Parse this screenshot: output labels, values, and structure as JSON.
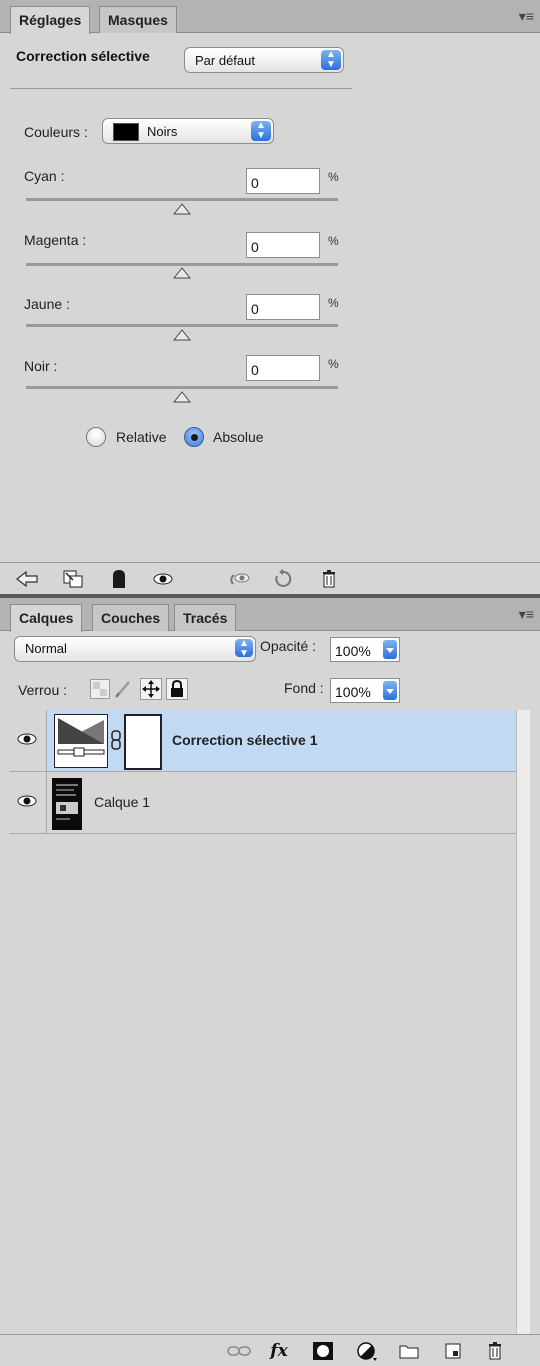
{
  "adjustments_panel": {
    "tabs": [
      "Réglages",
      "Masques"
    ],
    "menu_icon": "panel-menu-icon",
    "title": "Correction sélective",
    "preset": "Par défaut",
    "colors_label": "Couleurs :",
    "colors_value": "Noirs",
    "swatch_color": "#000000",
    "sliders": [
      {
        "label": "Cyan :",
        "value": "0",
        "unit": "%"
      },
      {
        "label": "Magenta :",
        "value": "0",
        "unit": "%"
      },
      {
        "label": "Jaune :",
        "value": "0",
        "unit": "%"
      },
      {
        "label": "Noir :",
        "value": "0",
        "unit": "%"
      }
    ],
    "method_options": [
      {
        "label": "Relative",
        "selected": false
      },
      {
        "label": "Absolue",
        "selected": true
      }
    ],
    "bottom_icons": [
      "back-arrow-icon",
      "clip-to-layer-icon",
      "mask-icon",
      "eye-icon",
      "view-previous-icon",
      "reset-icon",
      "trash-icon"
    ]
  },
  "layers_panel": {
    "tabs": [
      "Calques",
      "Couches",
      "Tracés"
    ],
    "blend_mode": "Normal",
    "opacity_label": "Opacité :",
    "opacity_value": "100%",
    "lock_label": "Verrou :",
    "fill_label": "Fond :",
    "fill_value": "100%",
    "layers": [
      {
        "name": "Correction sélective 1",
        "selected": true,
        "visible": true
      },
      {
        "name": "Calque 1",
        "selected": false,
        "visible": true
      }
    ],
    "bottom_icons": [
      "link-layers-icon",
      "fx-icon",
      "add-mask-icon",
      "adjustment-layer-icon",
      "group-folder-icon",
      "new-layer-icon",
      "trash-icon"
    ],
    "fx_text": "fx"
  },
  "colors": {
    "panel_bg": "#d6d6d6",
    "tabbar_bg": "#b3b3b3",
    "selection": "#c2d9f4",
    "accent_blue": "#3f7fdc"
  }
}
